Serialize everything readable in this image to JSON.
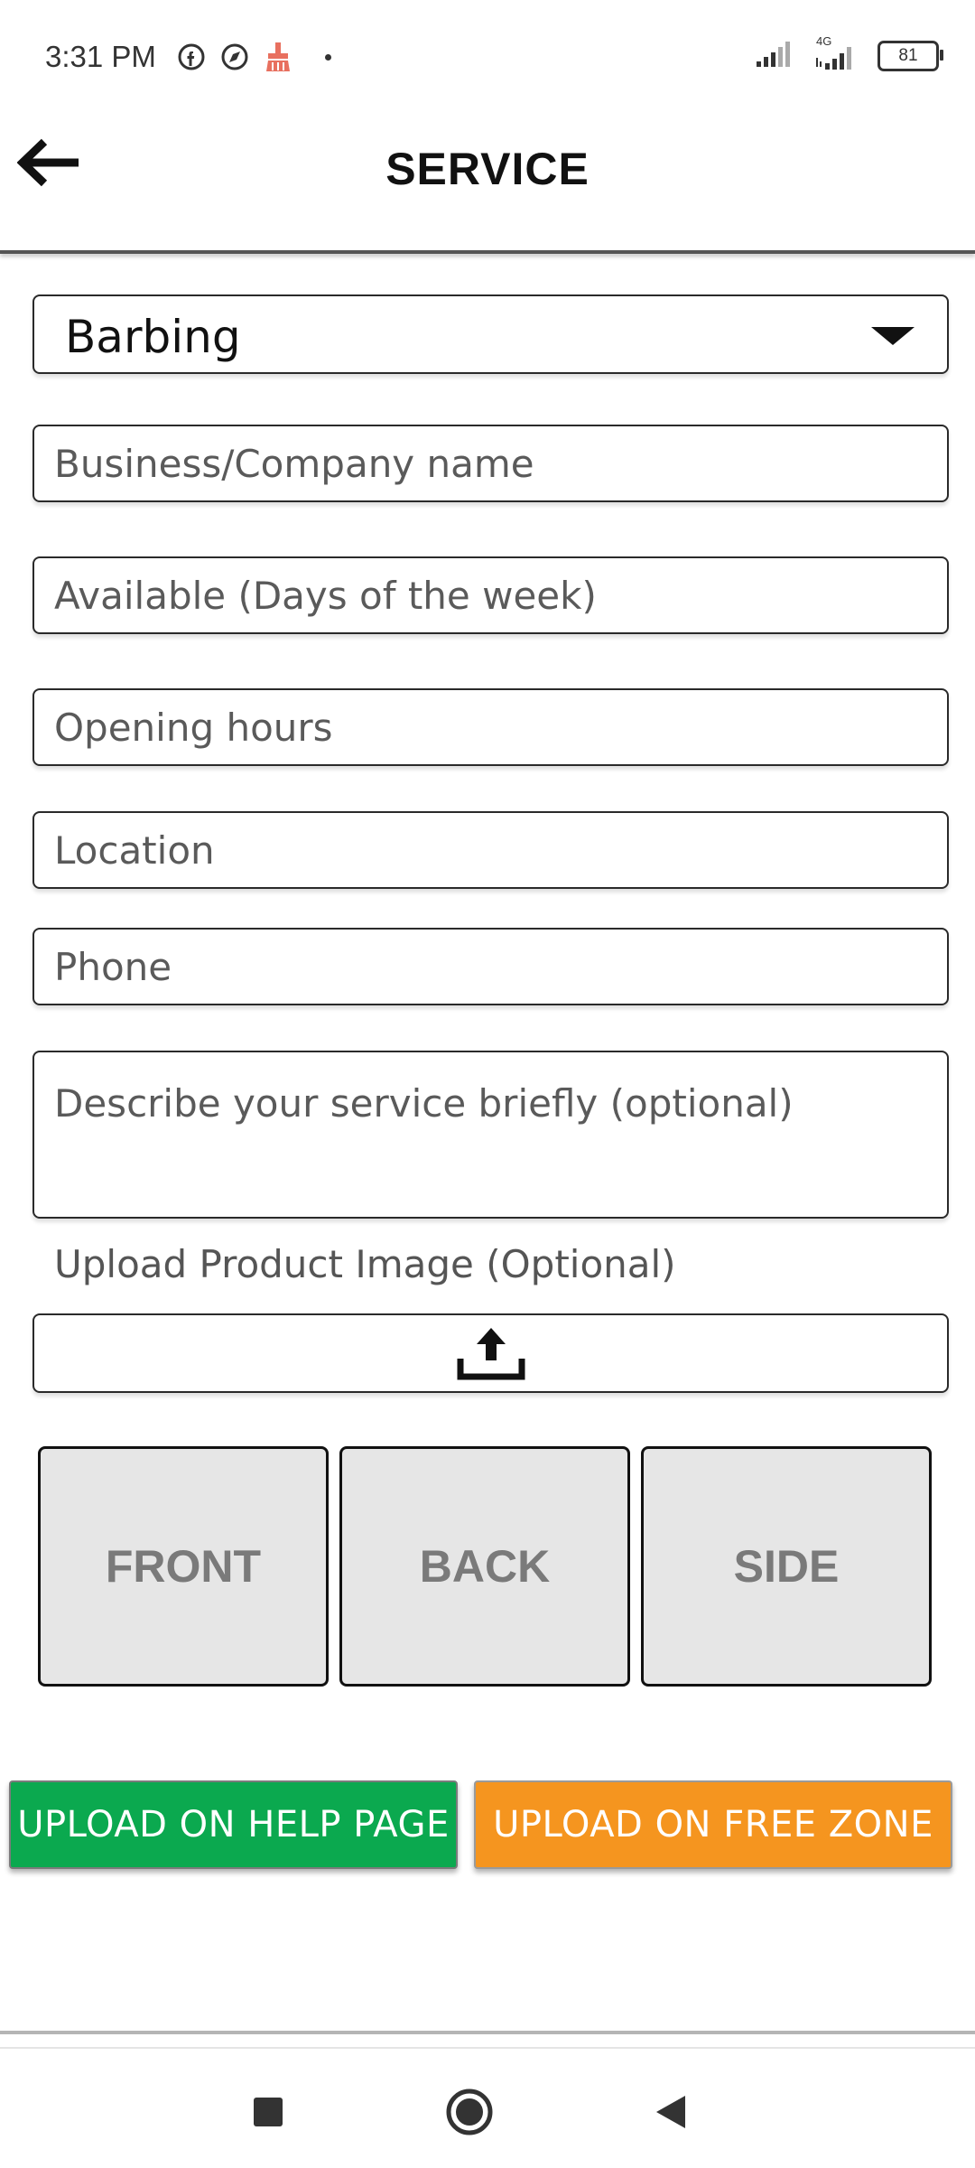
{
  "status_bar": {
    "time": "3:31 PM",
    "left_icons": [
      "facebook-icon",
      "compass-icon",
      "cleaner-icon"
    ],
    "network_label": "4G",
    "battery": "81"
  },
  "header": {
    "back_icon": "arrow-left-icon",
    "title": "SERVICE"
  },
  "form": {
    "category_select": {
      "value": "Barbing"
    },
    "business_name": {
      "placeholder": "Business/Company name"
    },
    "available_days": {
      "placeholder": "Available (Days of the week)"
    },
    "opening_hours": {
      "placeholder": "Opening hours"
    },
    "location": {
      "placeholder": "Location"
    },
    "phone": {
      "placeholder": "Phone"
    },
    "description": {
      "placeholder": "Describe your service briefly (optional)"
    },
    "upload_label": "Upload Product Image (Optional)",
    "upload_icon": "upload-icon"
  },
  "image_slots": [
    {
      "label": "FRONT"
    },
    {
      "label": "BACK"
    },
    {
      "label": "SIDE"
    }
  ],
  "actions": {
    "help_page": "UPLOAD ON HELP PAGE",
    "free_zone": "UPLOAD ON FREE ZONE"
  },
  "nav_bar": {
    "icons": [
      "recents-square-icon",
      "home-circle-icon",
      "back-triangle-icon"
    ]
  },
  "colors": {
    "help_button": "#0ba94f",
    "free_zone_button": "#f5951f",
    "slot_background": "#e6e6e6",
    "cleaner_icon": "#e8705f"
  }
}
